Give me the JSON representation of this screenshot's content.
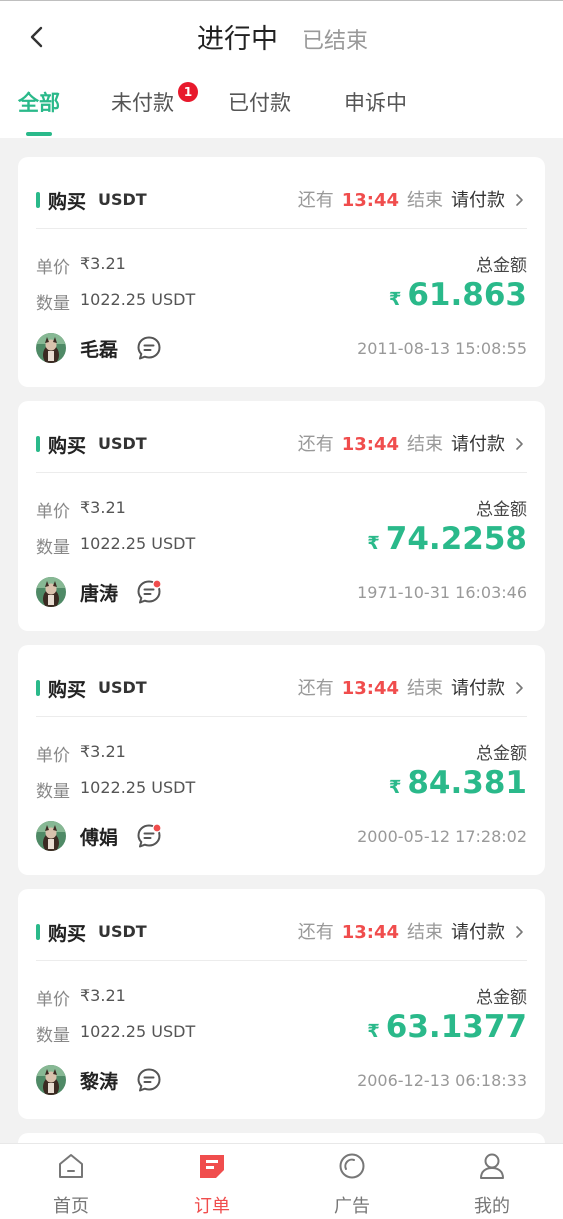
{
  "header": {
    "segment_active": "进行中",
    "segment_inactive": "已结束"
  },
  "tabs": [
    {
      "label": "全部",
      "selected": true
    },
    {
      "label": "未付款",
      "badge": "1"
    },
    {
      "label": "已付款"
    },
    {
      "label": "申诉中"
    }
  ],
  "colors": {
    "accent": "#2ab98a",
    "alert": "#f04d4d",
    "badge": "#e8192c"
  },
  "orders": [
    {
      "type": "购买",
      "coin": "USDT",
      "status_prefix": "还有",
      "time_left": "13:44",
      "status_mid": "结束",
      "status": "请付款",
      "price_label": "单价",
      "price": "₹3.21",
      "qty_label": "数量",
      "qty": "1022.25 USDT",
      "total_label": "总金额",
      "currency": "₹",
      "amount": "61.863",
      "name": "毛磊",
      "unread": false,
      "timestamp": "2011-08-13 15:08:55"
    },
    {
      "type": "购买",
      "coin": "USDT",
      "status_prefix": "还有",
      "time_left": "13:44",
      "status_mid": "结束",
      "status": "请付款",
      "price_label": "单价",
      "price": "₹3.21",
      "qty_label": "数量",
      "qty": "1022.25 USDT",
      "total_label": "总金额",
      "currency": "₹",
      "amount": "74.2258",
      "name": "唐涛",
      "unread": true,
      "timestamp": "1971-10-31 16:03:46"
    },
    {
      "type": "购买",
      "coin": "USDT",
      "status_prefix": "还有",
      "time_left": "13:44",
      "status_mid": "结束",
      "status": "请付款",
      "price_label": "单价",
      "price": "₹3.21",
      "qty_label": "数量",
      "qty": "1022.25 USDT",
      "total_label": "总金额",
      "currency": "₹",
      "amount": "84.381",
      "name": "傅娟",
      "unread": true,
      "timestamp": "2000-05-12 17:28:02"
    },
    {
      "type": "购买",
      "coin": "USDT",
      "status_prefix": "还有",
      "time_left": "13:44",
      "status_mid": "结束",
      "status": "请付款",
      "price_label": "单价",
      "price": "₹3.21",
      "qty_label": "数量",
      "qty": "1022.25 USDT",
      "total_label": "总金额",
      "currency": "₹",
      "amount": "63.1377",
      "name": "黎涛",
      "unread": false,
      "timestamp": "2006-12-13 06:18:33"
    }
  ],
  "nav": [
    {
      "label": "首页",
      "icon": "home-icon"
    },
    {
      "label": "订单",
      "icon": "order-icon",
      "selected": true
    },
    {
      "label": "广告",
      "icon": "ad-icon"
    },
    {
      "label": "我的",
      "icon": "profile-icon"
    }
  ]
}
